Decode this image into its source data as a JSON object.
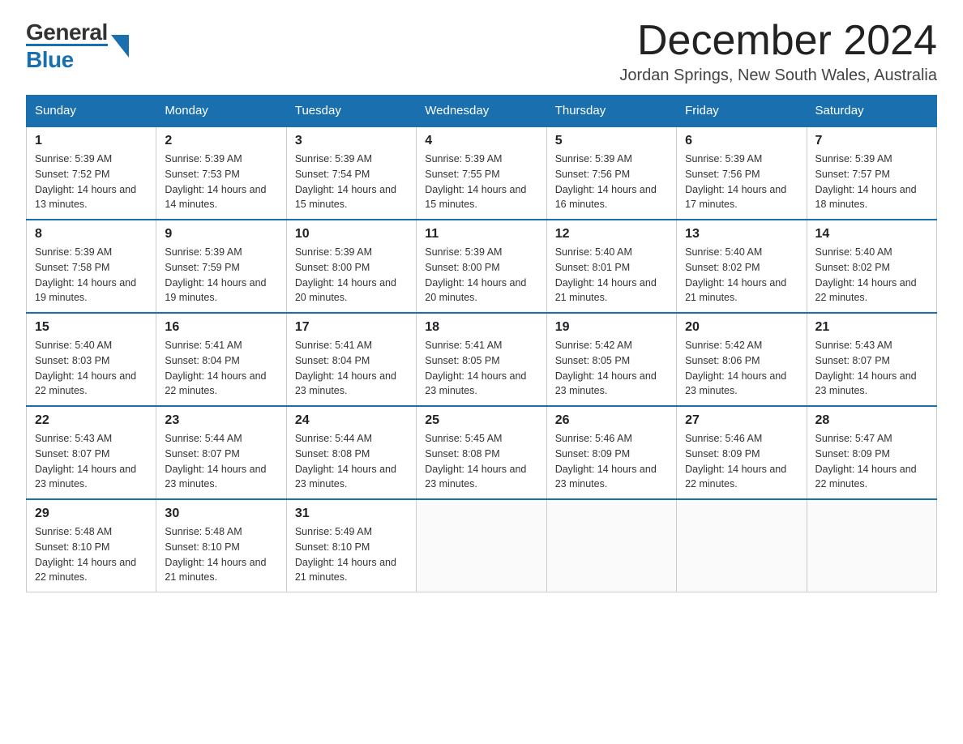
{
  "header": {
    "month_title": "December 2024",
    "location": "Jordan Springs, New South Wales, Australia",
    "logo_general": "General",
    "logo_blue": "Blue"
  },
  "calendar": {
    "days_of_week": [
      "Sunday",
      "Monday",
      "Tuesday",
      "Wednesday",
      "Thursday",
      "Friday",
      "Saturday"
    ],
    "weeks": [
      [
        {
          "day": "1",
          "sunrise": "5:39 AM",
          "sunset": "7:52 PM",
          "daylight": "14 hours and 13 minutes."
        },
        {
          "day": "2",
          "sunrise": "5:39 AM",
          "sunset": "7:53 PM",
          "daylight": "14 hours and 14 minutes."
        },
        {
          "day": "3",
          "sunrise": "5:39 AM",
          "sunset": "7:54 PM",
          "daylight": "14 hours and 15 minutes."
        },
        {
          "day": "4",
          "sunrise": "5:39 AM",
          "sunset": "7:55 PM",
          "daylight": "14 hours and 15 minutes."
        },
        {
          "day": "5",
          "sunrise": "5:39 AM",
          "sunset": "7:56 PM",
          "daylight": "14 hours and 16 minutes."
        },
        {
          "day": "6",
          "sunrise": "5:39 AM",
          "sunset": "7:56 PM",
          "daylight": "14 hours and 17 minutes."
        },
        {
          "day": "7",
          "sunrise": "5:39 AM",
          "sunset": "7:57 PM",
          "daylight": "14 hours and 18 minutes."
        }
      ],
      [
        {
          "day": "8",
          "sunrise": "5:39 AM",
          "sunset": "7:58 PM",
          "daylight": "14 hours and 19 minutes."
        },
        {
          "day": "9",
          "sunrise": "5:39 AM",
          "sunset": "7:59 PM",
          "daylight": "14 hours and 19 minutes."
        },
        {
          "day": "10",
          "sunrise": "5:39 AM",
          "sunset": "8:00 PM",
          "daylight": "14 hours and 20 minutes."
        },
        {
          "day": "11",
          "sunrise": "5:39 AM",
          "sunset": "8:00 PM",
          "daylight": "14 hours and 20 minutes."
        },
        {
          "day": "12",
          "sunrise": "5:40 AM",
          "sunset": "8:01 PM",
          "daylight": "14 hours and 21 minutes."
        },
        {
          "day": "13",
          "sunrise": "5:40 AM",
          "sunset": "8:02 PM",
          "daylight": "14 hours and 21 minutes."
        },
        {
          "day": "14",
          "sunrise": "5:40 AM",
          "sunset": "8:02 PM",
          "daylight": "14 hours and 22 minutes."
        }
      ],
      [
        {
          "day": "15",
          "sunrise": "5:40 AM",
          "sunset": "8:03 PM",
          "daylight": "14 hours and 22 minutes."
        },
        {
          "day": "16",
          "sunrise": "5:41 AM",
          "sunset": "8:04 PM",
          "daylight": "14 hours and 22 minutes."
        },
        {
          "day": "17",
          "sunrise": "5:41 AM",
          "sunset": "8:04 PM",
          "daylight": "14 hours and 23 minutes."
        },
        {
          "day": "18",
          "sunrise": "5:41 AM",
          "sunset": "8:05 PM",
          "daylight": "14 hours and 23 minutes."
        },
        {
          "day": "19",
          "sunrise": "5:42 AM",
          "sunset": "8:05 PM",
          "daylight": "14 hours and 23 minutes."
        },
        {
          "day": "20",
          "sunrise": "5:42 AM",
          "sunset": "8:06 PM",
          "daylight": "14 hours and 23 minutes."
        },
        {
          "day": "21",
          "sunrise": "5:43 AM",
          "sunset": "8:07 PM",
          "daylight": "14 hours and 23 minutes."
        }
      ],
      [
        {
          "day": "22",
          "sunrise": "5:43 AM",
          "sunset": "8:07 PM",
          "daylight": "14 hours and 23 minutes."
        },
        {
          "day": "23",
          "sunrise": "5:44 AM",
          "sunset": "8:07 PM",
          "daylight": "14 hours and 23 minutes."
        },
        {
          "day": "24",
          "sunrise": "5:44 AM",
          "sunset": "8:08 PM",
          "daylight": "14 hours and 23 minutes."
        },
        {
          "day": "25",
          "sunrise": "5:45 AM",
          "sunset": "8:08 PM",
          "daylight": "14 hours and 23 minutes."
        },
        {
          "day": "26",
          "sunrise": "5:46 AM",
          "sunset": "8:09 PM",
          "daylight": "14 hours and 23 minutes."
        },
        {
          "day": "27",
          "sunrise": "5:46 AM",
          "sunset": "8:09 PM",
          "daylight": "14 hours and 22 minutes."
        },
        {
          "day": "28",
          "sunrise": "5:47 AM",
          "sunset": "8:09 PM",
          "daylight": "14 hours and 22 minutes."
        }
      ],
      [
        {
          "day": "29",
          "sunrise": "5:48 AM",
          "sunset": "8:10 PM",
          "daylight": "14 hours and 22 minutes."
        },
        {
          "day": "30",
          "sunrise": "5:48 AM",
          "sunset": "8:10 PM",
          "daylight": "14 hours and 21 minutes."
        },
        {
          "day": "31",
          "sunrise": "5:49 AM",
          "sunset": "8:10 PM",
          "daylight": "14 hours and 21 minutes."
        },
        null,
        null,
        null,
        null
      ]
    ]
  }
}
